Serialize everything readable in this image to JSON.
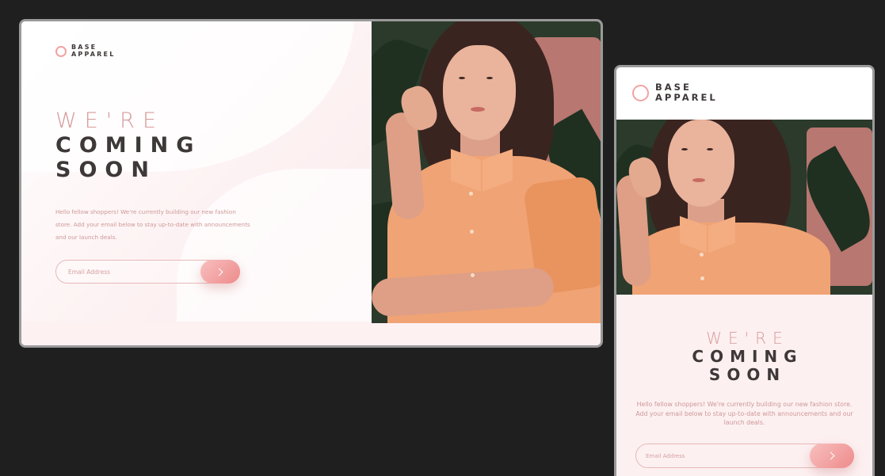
{
  "brand": {
    "line1": "BASE",
    "line2": "APPAREL"
  },
  "hero": {
    "heading_light": "WE'RE",
    "heading_line2": "COMING",
    "heading_line3": "SOON",
    "description": "Hello fellow shoppers! We're currently building our new fashion store. Add your email below to stay up-to-date with announcements and our launch deals."
  },
  "form": {
    "email_placeholder": "Email Address",
    "submit_icon": "chevron-right-icon"
  },
  "photo": {
    "alt": "hero-image"
  },
  "colors": {
    "accent": "#f3a2a2",
    "text_dark": "#3e3838",
    "text_soft": "#ce9898",
    "background": "#fdf0f1",
    "page_bg": "#1f1f1f"
  }
}
